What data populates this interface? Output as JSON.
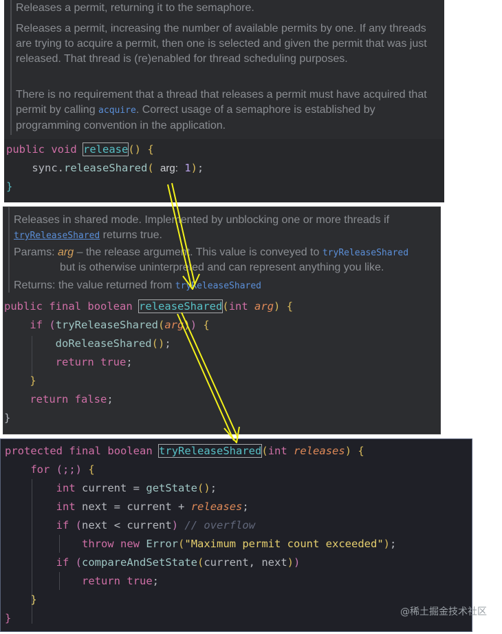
{
  "panel1": {
    "doc_summary": "Releases a permit, returning it to the semaphore.",
    "doc_para1": "Releases a permit, increasing the number of available permits by one. If any threads are trying to acquire a permit, then one is selected and given the permit that was just released. That thread is (re)enabled for thread scheduling purposes.",
    "doc_para2_before": "There is no requirement that a thread that releases a permit must have acquired that permit by calling ",
    "doc_para2_link": "acquire",
    "doc_para2_after": ". Correct usage of a semaphore is established by programming convention in the application.",
    "code": {
      "kw_public": "public",
      "kw_void": "void",
      "method": "release",
      "parens": "()",
      "open_brace": "{",
      "sync": "sync",
      "call": "releaseShared",
      "hint": "arg:",
      "arg_value": "1",
      "close_brace": "}"
    }
  },
  "panel2": {
    "doc_summary": "Releases in shared mode. Implemented by unblocking one or more threads if",
    "doc_summary_link": "tryReleaseShared",
    "doc_summary_tail": " returns true.",
    "params_label": "Params:",
    "param_name": "arg",
    "param_desc": " – the release argument. This value is conveyed to ",
    "param_link": "tryReleaseShared",
    "param_desc2": "but is otherwise uninterpreted and can represent anything you like.",
    "returns_label": "Returns:",
    "returns_text": " the value returned from ",
    "returns_link": "tryReleaseShared",
    "code": {
      "kw_public": "public",
      "kw_final": "final",
      "kw_boolean": "boolean",
      "method": "releaseShared",
      "type_int": "int",
      "param": "arg",
      "kw_if": "if",
      "call_try": "tryReleaseShared",
      "call_do": "doReleaseShared",
      "kw_return": "return",
      "kw_true": "true",
      "kw_false": "false"
    }
  },
  "panel3": {
    "code": {
      "kw_protected": "protected",
      "kw_final": "final",
      "kw_boolean": "boolean",
      "method": "tryReleaseShared",
      "type_int": "int",
      "param": "releases",
      "kw_for": "for",
      "for_cond": "(;;)",
      "var_current": "current",
      "call_getstate": "getState",
      "var_next": "next",
      "kw_if": "if",
      "comment": "// overflow",
      "kw_throw": "throw",
      "kw_new": "new",
      "class_error": "Error",
      "error_msg": "\"Maximum permit count exceeded\"",
      "call_cas": "compareAndSetState",
      "kw_return": "return",
      "kw_true": "true"
    }
  },
  "watermark": "@稀土掘金技术社区",
  "colors": {
    "arrow": "#f4f21a",
    "panel_bg": "#2b2c2f",
    "panel3_bg": "#1f2027"
  }
}
